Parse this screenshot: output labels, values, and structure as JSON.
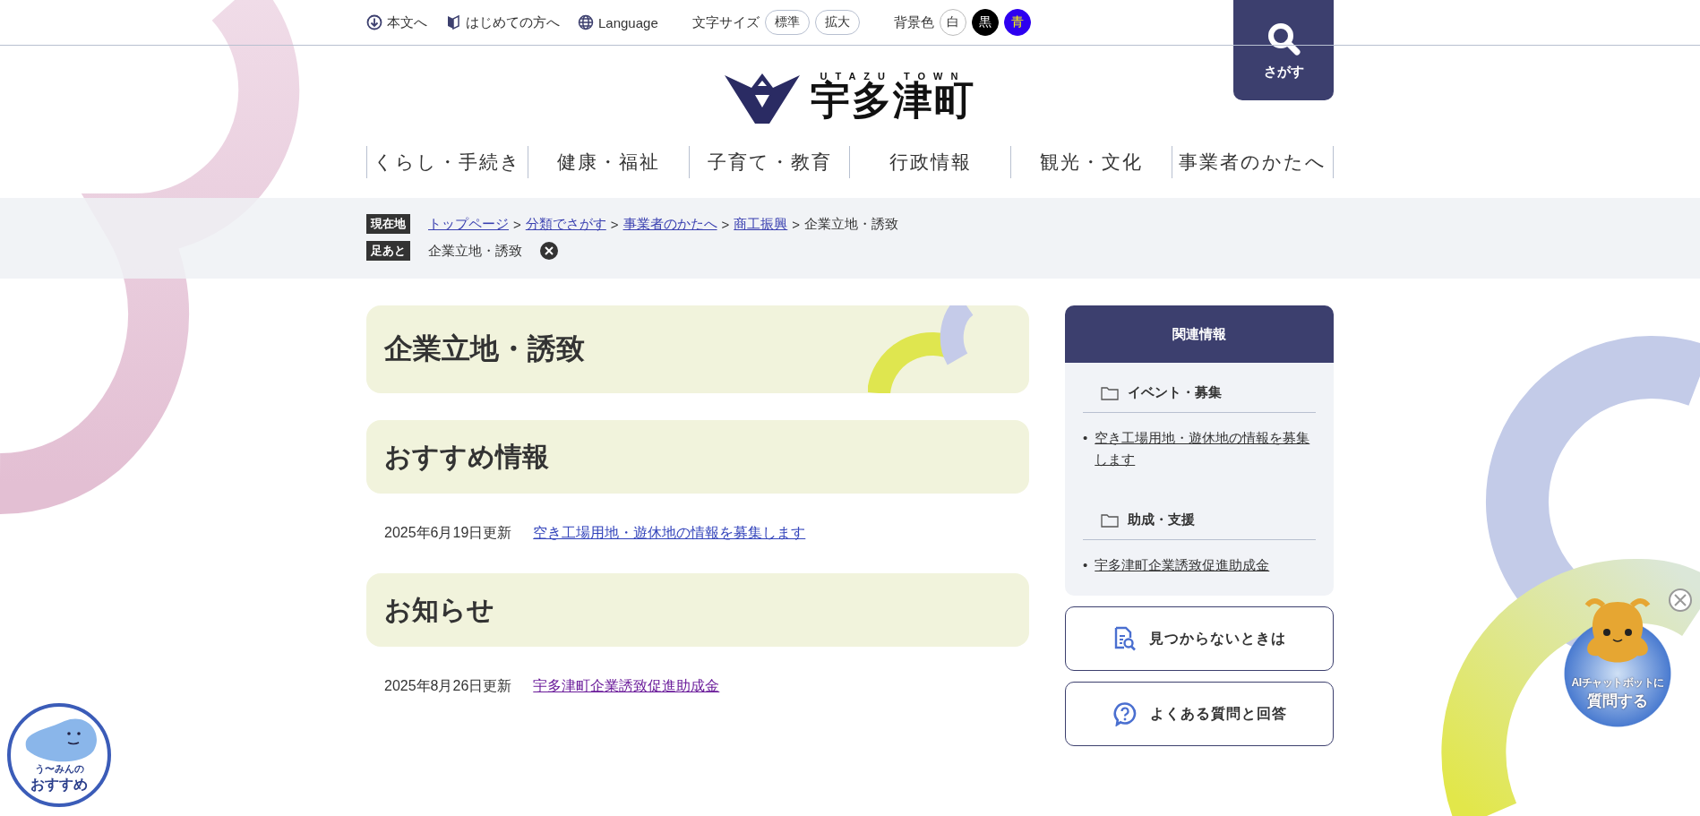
{
  "utility_bar": {
    "links": [
      {
        "kind": "skip",
        "label": "本文へ"
      },
      {
        "kind": "beginner",
        "label": "はじめての方へ"
      },
      {
        "kind": "language",
        "label": "Language"
      }
    ],
    "font_size": {
      "label": "文字サイズ",
      "options": [
        {
          "label": "標準"
        },
        {
          "label": "拡大"
        }
      ]
    },
    "background": {
      "label": "背景色",
      "options": [
        {
          "kind": "white",
          "label": "白"
        },
        {
          "kind": "black",
          "label": "黒"
        },
        {
          "kind": "blue",
          "label": "青"
        }
      ]
    }
  },
  "search_button": {
    "label": "さがす"
  },
  "logo": {
    "tagline": "UTAZU TOWN",
    "name": "宇多津町"
  },
  "global_nav": [
    "くらし・手続き",
    "健康・福祉",
    "子育て・教育",
    "行政情報",
    "観光・文化",
    "事業者のかたへ"
  ],
  "breadcrumb": {
    "label": "現在地",
    "links": [
      "トップページ",
      "分類でさがす",
      "事業者のかたへ",
      "商工振興"
    ],
    "separator": ">",
    "current": "企業立地・誘致"
  },
  "footprint": {
    "label": "足あと",
    "items": [
      "企業立地・誘致"
    ]
  },
  "page_title": "企業立地・誘致",
  "sections": [
    {
      "heading": "おすすめ情報",
      "items": [
        {
          "date": "2025年6月19日更新",
          "title": "空き工場用地・遊休地の情報を募集します",
          "visited": false
        }
      ]
    },
    {
      "heading": "お知らせ",
      "items": [
        {
          "date": "2025年8月26日更新",
          "title": "宇多津町企業誘致促進助成金",
          "visited": true
        }
      ]
    }
  ],
  "sidebar": {
    "heading": "関連情報",
    "marker": "•",
    "groups": [
      {
        "title": "イベント・募集",
        "links": [
          "空き工場用地・遊休地の情報を募集します"
        ]
      },
      {
        "title": "助成・支援",
        "links": [
          "宇多津町企業誘致促進助成金"
        ]
      }
    ],
    "buttons": [
      {
        "kind": "search-doc",
        "label": "見つからないときは"
      },
      {
        "kind": "faq",
        "label": "よくある質問と回答"
      }
    ]
  },
  "mascot_badge": {
    "line1": "う〜みんの",
    "line2": "おすすめ"
  },
  "chatbot_badge": {
    "line1": "AIチャットボットに",
    "line2": "質問する"
  }
}
